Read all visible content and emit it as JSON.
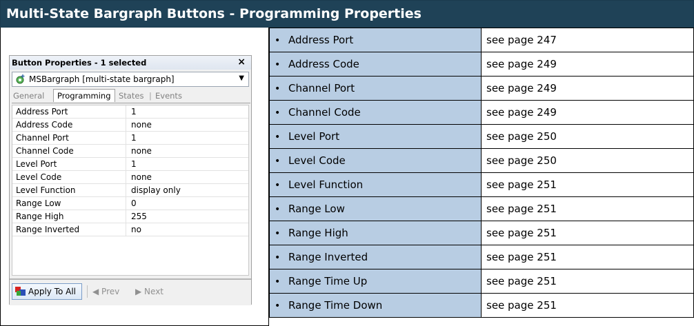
{
  "header": {
    "title": "Multi-State Bargraph Buttons - Programming Properties"
  },
  "dialog": {
    "title": "Button Properties - 1 selected",
    "combo_value": "MSBargraph  [multi-state bargraph]",
    "tabs": [
      "General",
      "Programming",
      "States",
      "Events"
    ],
    "active_tab": "Programming",
    "rows": [
      {
        "name": "Address Port",
        "value": "1"
      },
      {
        "name": "Address Code",
        "value": "none"
      },
      {
        "name": "Channel Port",
        "value": "1"
      },
      {
        "name": "Channel Code",
        "value": "none"
      },
      {
        "name": "Level Port",
        "value": "1"
      },
      {
        "name": "Level Code",
        "value": "none"
      },
      {
        "name": "Level Function",
        "value": "display only"
      },
      {
        "name": "Range Low",
        "value": "0"
      },
      {
        "name": "Range High",
        "value": "255"
      },
      {
        "name": "Range Inverted",
        "value": "no"
      }
    ],
    "apply_label": "Apply To All",
    "prev_label": "Prev",
    "next_label": "Next"
  },
  "properties": [
    {
      "name": "Address Port",
      "ref": "see page 247"
    },
    {
      "name": "Address Code",
      "ref": "see page 249"
    },
    {
      "name": "Channel Port",
      "ref": "see page 249"
    },
    {
      "name": "Channel Code",
      "ref": "see page 249"
    },
    {
      "name": "Level Port",
      "ref": "see page 250"
    },
    {
      "name": "Level Code",
      "ref": "see page 250"
    },
    {
      "name": "Level Function",
      "ref": "see page 251"
    },
    {
      "name": "Range Low",
      "ref": "see page 251"
    },
    {
      "name": "Range High",
      "ref": "see page 251"
    },
    {
      "name": "Range Inverted",
      "ref": "see page 251"
    },
    {
      "name": "Range Time Up",
      "ref": "see page 251"
    },
    {
      "name": "Range Time Down",
      "ref": "see page 251"
    }
  ],
  "colors": {
    "header_bg": "#1f4257",
    "name_cell_bg": "#b8cde3"
  }
}
